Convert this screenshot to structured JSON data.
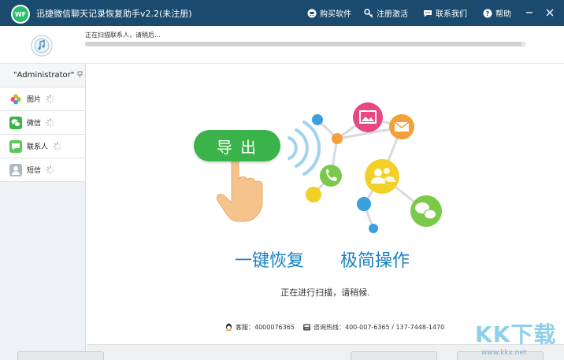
{
  "app": {
    "logo_text": "WF",
    "title": "迅捷微信聊天记录恢复助手v2.2(未注册)",
    "menu": {
      "buy": "购买软件",
      "register": "注册激活",
      "contact": "联系我们",
      "help": "帮助"
    }
  },
  "status": {
    "text": "正在扫描联系人，请稍后...",
    "progress": 0.99
  },
  "sidebar": {
    "user": "\"Administrator\"",
    "user_suffix": "",
    "items": [
      {
        "label": "图片",
        "icon": "photos-icon",
        "state": "loading"
      },
      {
        "label": "微信",
        "icon": "wechat-icon",
        "state": "loading"
      },
      {
        "label": "联系人",
        "icon": "contacts-icon",
        "state": "loading"
      },
      {
        "label": "短信",
        "icon": "sms-icon",
        "state": "loading"
      }
    ]
  },
  "main": {
    "export_label": "导出",
    "slogan_left": "一键恢复",
    "slogan_right": "极简操作",
    "scan_message": "正在进行扫描，请稍候.",
    "qq_label": "客服：4000076365",
    "hotline_label": "咨询热线：400-007-6365 / 137-7448-1470"
  },
  "watermark": {
    "text": "KK下载",
    "url": "www.kkx.net"
  },
  "colors": {
    "titlebar": "#1a4b6e",
    "accent_green": "#3ab34a",
    "slogan_blue": "#1a7fc1",
    "node_pink": "#e8477f",
    "node_orange": "#f3a03a",
    "node_yellow": "#f2d027",
    "node_green": "#7bc94b",
    "node_blue": "#3aa0dc"
  }
}
